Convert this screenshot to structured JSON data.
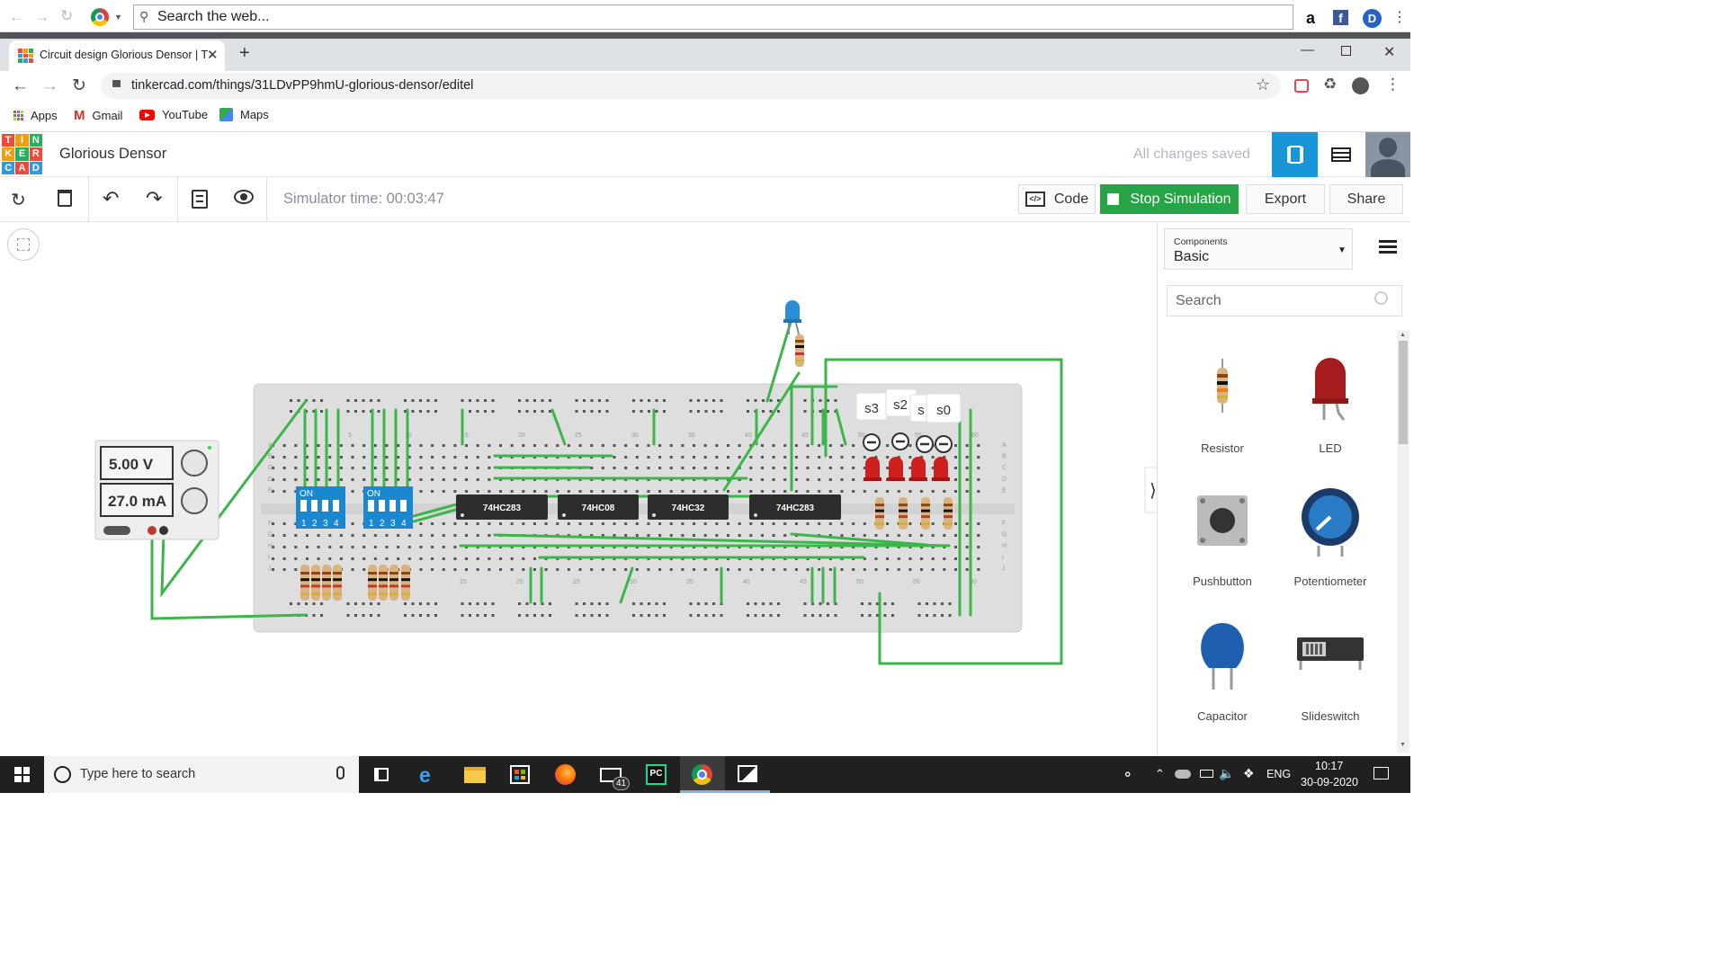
{
  "top_search": {
    "placeholder": "Search the web..."
  },
  "tab": {
    "title": "Circuit design Glorious Densor | T"
  },
  "address": {
    "url": "tinkercad.com/things/31LDvPP9hmU-glorious-densor/editel"
  },
  "bookmarks": [
    {
      "label": "Apps",
      "icon": "apps-grid-icon"
    },
    {
      "label": "Gmail",
      "icon": "gmail-icon"
    },
    {
      "label": "YouTube",
      "icon": "youtube-icon"
    },
    {
      "label": "Maps",
      "icon": "maps-icon"
    }
  ],
  "app": {
    "logo_letters": [
      "T",
      "I",
      "N",
      "K",
      "E",
      "R",
      "C",
      "A",
      "D"
    ],
    "project_title": "Glorious Densor",
    "save_status": "All changes saved",
    "accent_color": "#1996d7"
  },
  "toolbar": {
    "simulator_time": "Simulator time: 00:03:47",
    "code_label": "Code",
    "stop_label": "Stop Simulation",
    "export_label": "Export",
    "share_label": "Share",
    "stop_color": "#27a445"
  },
  "power_supply": {
    "voltage": "5.00 V",
    "current": "27.0 mA"
  },
  "dip_switches": [
    {
      "label": "ON",
      "pins": [
        "1",
        "2",
        "3",
        "4"
      ]
    },
    {
      "label": "ON",
      "pins": [
        "1",
        "2",
        "3",
        "4"
      ]
    }
  ],
  "chips": [
    "74HC283",
    "74HC08",
    "74HC32",
    "74HC283"
  ],
  "led_labels": [
    "s3",
    "s2",
    "s",
    "s0"
  ],
  "breadboard": {
    "column_numbers_top": [
      "5",
      "10",
      "15",
      "20",
      "25",
      "30",
      "35",
      "40",
      "45",
      "50",
      "55",
      "60"
    ],
    "column_numbers_bottom": [
      "15",
      "20",
      "25",
      "30",
      "35",
      "40",
      "45",
      "50",
      "55",
      "60"
    ],
    "row_letters_top": [
      "A",
      "B",
      "C",
      "D",
      "E"
    ],
    "row_letters_bottom": [
      "F",
      "G",
      "H",
      "I",
      "J"
    ]
  },
  "panel": {
    "category_caption": "Components",
    "category_value": "Basic",
    "search_placeholder": "Search",
    "components": [
      {
        "label": "Resistor",
        "icon": "resistor-icon"
      },
      {
        "label": "LED",
        "icon": "led-icon"
      },
      {
        "label": "Pushbutton",
        "icon": "pushbutton-icon"
      },
      {
        "label": "Potentiometer",
        "icon": "potentiometer-icon"
      },
      {
        "label": "Capacitor",
        "icon": "capacitor-icon"
      },
      {
        "label": "Slideswitch",
        "icon": "slideswitch-icon"
      }
    ]
  },
  "taskbar": {
    "search_placeholder": "Type here to search",
    "mail_badge": "41",
    "language": "ENG",
    "time": "10:17",
    "date": "30-09-2020"
  }
}
